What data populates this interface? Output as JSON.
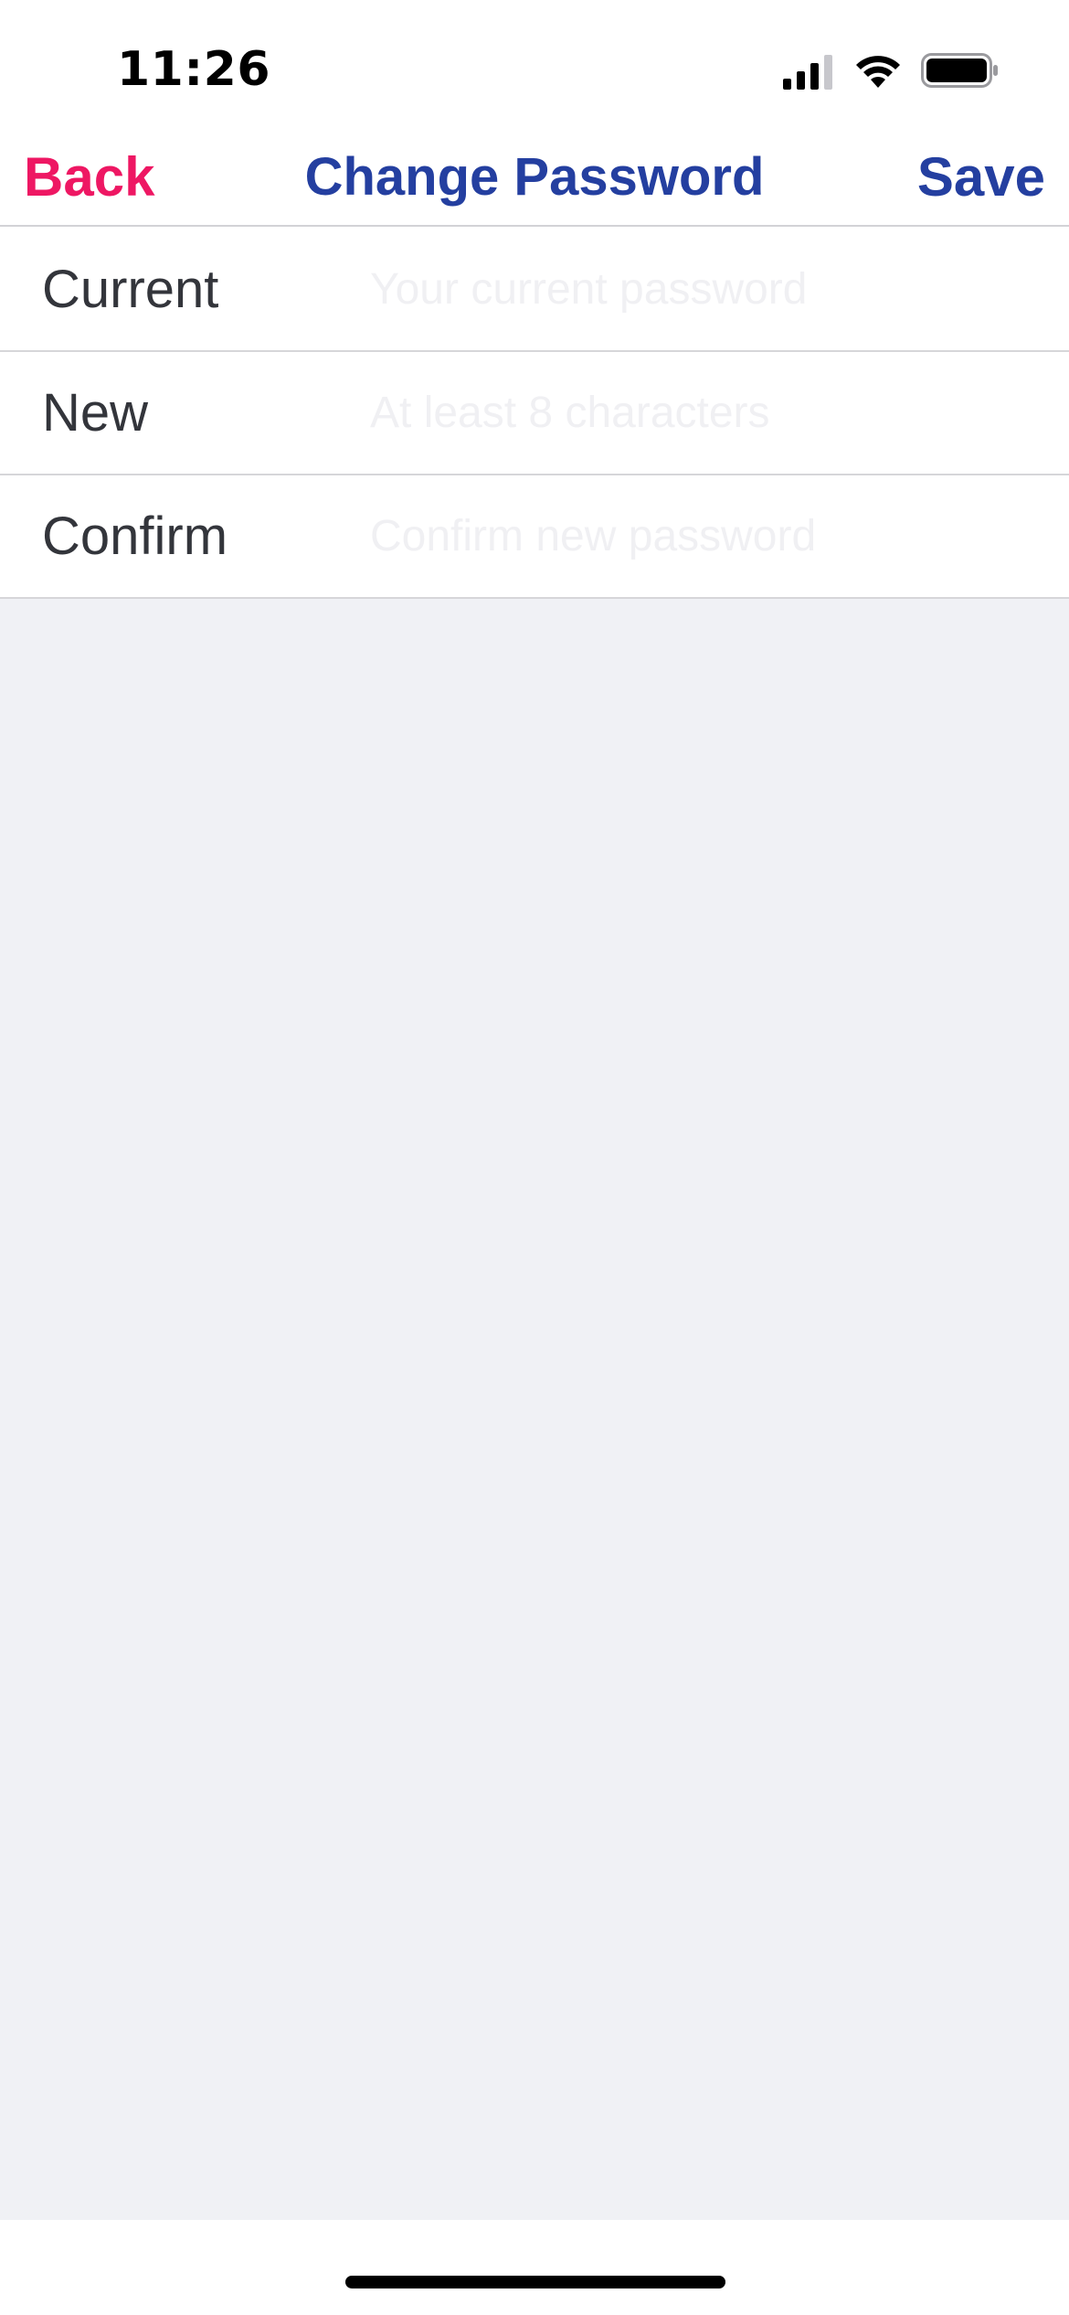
{
  "status_bar": {
    "time": "11:26",
    "icons": [
      "signal-icon",
      "wifi-icon",
      "battery-icon"
    ]
  },
  "nav": {
    "back_label": "Back",
    "title": "Change Password",
    "save_label": "Save"
  },
  "form": {
    "rows": [
      {
        "label": "Current",
        "placeholder": "Your current password",
        "value": ""
      },
      {
        "label": "New",
        "placeholder": "At least 8 characters",
        "value": ""
      },
      {
        "label": "Confirm",
        "placeholder": "Confirm new password",
        "value": ""
      }
    ]
  },
  "colors": {
    "back": "#ee1763",
    "accent": "#243fa0",
    "label": "#33353b",
    "grouped_background": "#f0f1f5",
    "separator": "#d6d6d9"
  }
}
